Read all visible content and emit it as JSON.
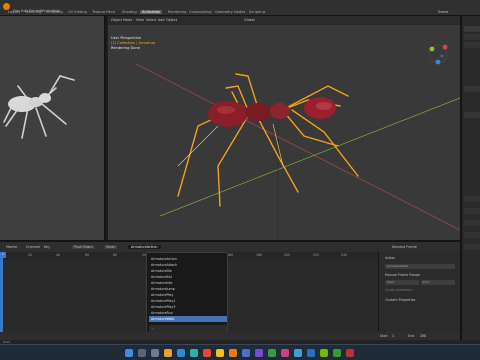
{
  "menubar": {
    "items": [
      "File",
      "Edit",
      "Render",
      "Window",
      "Help"
    ],
    "workspaces": [
      "Layout",
      "Modeling",
      "Sculpting",
      "UV Editing",
      "Texture Paint",
      "Shading",
      "Animation",
      "Rendering",
      "Compositing",
      "Geometry Nodes",
      "Scripting"
    ],
    "active_workspace": "Animation",
    "scene": "Scene"
  },
  "viewport": {
    "mode": "Object Mode",
    "header_menus": [
      "View",
      "Select",
      "Add",
      "Object"
    ],
    "transform": "Global",
    "overlay": {
      "line1": "User Perspective",
      "line2": "(1) Collection | Armature",
      "line3": "Rendering Done"
    }
  },
  "timeline": {
    "menus": [
      "Marker",
      "Channel",
      "Key"
    ],
    "push_down": "Push Down",
    "stash": "Stash",
    "current_action": "ArmatureAction",
    "nearest_frame": "Nearest Frame",
    "frames": [
      "0",
      "20",
      "40",
      "60",
      "80",
      "100",
      "120",
      "140",
      "160",
      "180",
      "200",
      "220",
      "240"
    ],
    "current_frame": "1"
  },
  "action_dropdown": {
    "items": [
      "ArmatureAction",
      "ArmatureAttack",
      "ArmatureDie",
      "ArmatureEat",
      "ArmatureIdle",
      "ArmatureJump",
      "ArmaturePlay",
      "ArmaturePlay2",
      "ArmaturePlay3",
      "ArmatureRun",
      "ArmatureWalk"
    ],
    "selected_index": 10
  },
  "action_panel": {
    "section": "Action",
    "action_name": "ArmatureWalk",
    "manual_range": "Manual Frame Range",
    "start_label": "Start",
    "end_label": "End",
    "cyclic": "Cyclic Animation",
    "custom_props": "Custom Properties"
  },
  "playback": {
    "start_label": "Start",
    "start": "1",
    "end_label": "End",
    "end": "250"
  },
  "status": "Orbit"
}
